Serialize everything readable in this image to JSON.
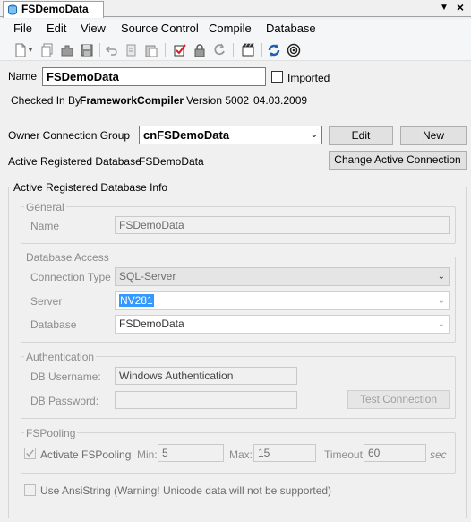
{
  "tab": {
    "title": "FSDemoData",
    "dropdown_icon": "dropdown-arrow-icon",
    "close_icon": "close-icon"
  },
  "menu": [
    "File",
    "Edit",
    "View",
    "Source Control",
    "Compile",
    "Database"
  ],
  "toolbar_icons": [
    "new-icon",
    "copy-icon",
    "plugin-icon",
    "save-icon",
    "undo-icon",
    "paste-copy-icon",
    "paste-icon",
    "checkin-icon",
    "lock-icon",
    "revert-icon",
    "build-icon",
    "refresh-icon",
    "target-icon"
  ],
  "form": {
    "name_label": "Name",
    "name_value": "FSDemoData",
    "imported_label": "Imported",
    "checked_in_label": "Checked In By",
    "checked_in_user": "FrameworkCompiler",
    "version_label": "Version 5002",
    "date": "04.03.2009",
    "owner_group_label": "Owner Connection Group",
    "owner_group_value": "cnFSDemoData",
    "edit_button": "Edit",
    "new_button": "New",
    "active_db_label": "Active Registered Database",
    "active_db_value": "FSDemoData",
    "change_connection_button": "Change Active Connection"
  },
  "info_group": {
    "title": "Active Registered Database Info",
    "general": {
      "title": "General",
      "name_label": "Name",
      "name_value": "FSDemoData"
    },
    "db_access": {
      "title": "Database Access",
      "conn_type_label": "Connection Type",
      "conn_type_value": "SQL-Server",
      "server_label": "Server",
      "server_value": "NV281",
      "database_label": "Database",
      "database_value": "FSDemoData"
    },
    "auth": {
      "title": "Authentication",
      "username_label": "DB Username:",
      "username_value": "Windows Authentication",
      "password_label": "DB Password:",
      "password_value": "",
      "test_button": "Test Connection"
    },
    "pooling": {
      "title": "FSPooling",
      "activate_label": "Activate FSPooling",
      "activate_checked": true,
      "min_label": "Min:",
      "min_value": "5",
      "max_label": "Max:",
      "max_value": "15",
      "timeout_label": "Timeout:",
      "timeout_value": "60",
      "sec_label": "sec"
    },
    "ansi_label": "Use AnsiString (Warning! Unicode data will not be supported)",
    "ansi_checked": false
  }
}
